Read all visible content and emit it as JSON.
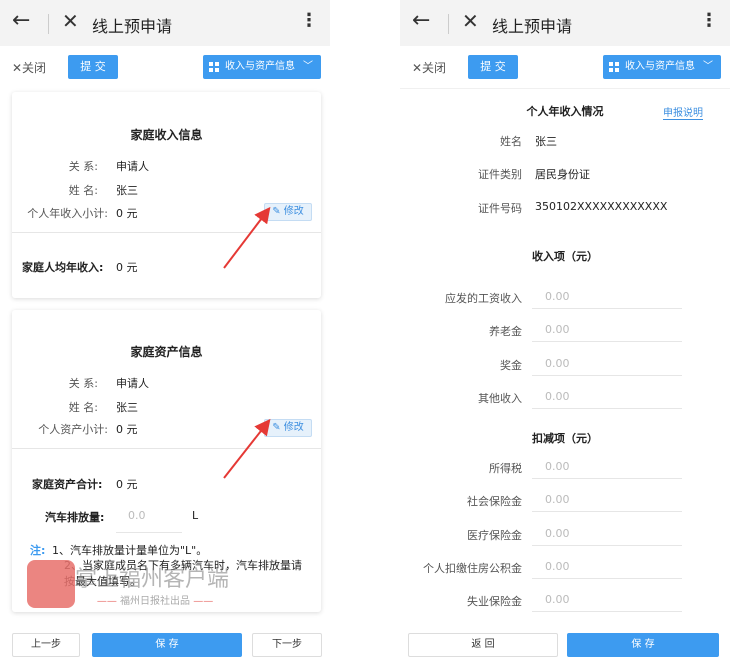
{
  "header": {
    "title": "线上预申请",
    "back_icon": "arrow-left-icon",
    "close_icon": "x-icon",
    "more_icon": "more-vertical-icon"
  },
  "toolbar": {
    "close_label": "✕关闭",
    "submit_label": "提 交",
    "dropdown_label": "收入与资产信息"
  },
  "left": {
    "income_card": {
      "title": "家庭收入信息",
      "relation_label": "关 系:",
      "relation_value": "申请人",
      "name_label": "姓 名:",
      "name_value": "张三",
      "subtotal_label": "个人年收入小计:",
      "subtotal_value": "0 元",
      "edit_label": "修改",
      "avg_label": "家庭人均年收入:",
      "avg_value": "0 元"
    },
    "asset_card": {
      "title": "家庭资产信息",
      "relation_label": "关 系:",
      "relation_value": "申请人",
      "name_label": "姓 名:",
      "name_value": "张三",
      "subtotal_label": "个人资产小计:",
      "subtotal_value": "0 元",
      "edit_label": "修改",
      "total_label": "家庭资产合计:",
      "total_value": "0 元",
      "car_label": "汽车排放量:",
      "car_placeholder": "0.0",
      "car_unit": "L",
      "note_prefix": "注:",
      "note_1": "1、汽车排放量计量单位为\"L\"。",
      "note_2": "2、当家庭成员名下有多辆汽车时，汽车排放量请按最大值填写。"
    },
    "buttons": {
      "prev": "上一步",
      "save": "保 存",
      "next": "下一步"
    },
    "annotation_color": "#e53935"
  },
  "watermark": {
    "text": "掌上福州客户端",
    "sub": "福州日报社出品"
  },
  "right": {
    "title": "个人年收入情况",
    "help_link": "申报说明",
    "name_label": "姓名",
    "name_value": "张三",
    "id_type_label": "证件类别",
    "id_type_value": "居民身份证",
    "id_no_label": "证件号码",
    "id_no_value": "350102XXXXXXXXXXXX",
    "income_section": "收入项（元）",
    "income_items": [
      {
        "label": "应发的工资收入",
        "placeholder": "0.00"
      },
      {
        "label": "养老金",
        "placeholder": "0.00"
      },
      {
        "label": "奖金",
        "placeholder": "0.00"
      },
      {
        "label": "其他收入",
        "placeholder": "0.00"
      }
    ],
    "deduct_section": "扣减项（元）",
    "deduct_items": [
      {
        "label": "所得税",
        "placeholder": "0.00"
      },
      {
        "label": "社会保险金",
        "placeholder": "0.00"
      },
      {
        "label": "医疗保险金",
        "placeholder": "0.00"
      },
      {
        "label": "个人扣缴住房公积金",
        "placeholder": "0.00"
      },
      {
        "label": "失业保险金",
        "placeholder": "0.00"
      }
    ],
    "buttons": {
      "back": "返 回",
      "save": "保 存"
    }
  },
  "accent_color": "#3d9bf0"
}
